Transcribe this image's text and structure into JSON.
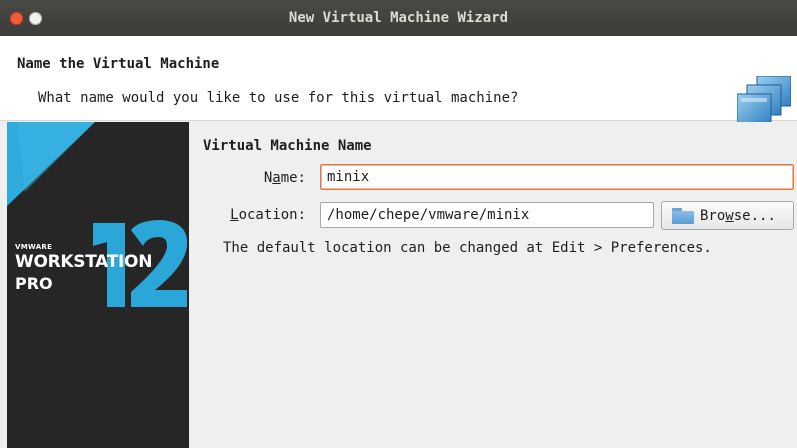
{
  "window": {
    "title": "New Virtual Machine Wizard"
  },
  "header": {
    "title": "Name the Virtual Machine",
    "subtitle": "What name would you like to use for this virtual machine?",
    "icon": "virtual-machine-stack-icon"
  },
  "banner": {
    "vendor": "VMWARE",
    "product": "WORKSTATION",
    "edition": "PRO",
    "version": "12",
    "colors": {
      "accent": "#2eaadc",
      "background": "#262626"
    }
  },
  "form": {
    "section_title": "Virtual Machine Name",
    "name": {
      "label_pre": "N",
      "label_mnemonic": "a",
      "label_post": "me:",
      "value": "minix"
    },
    "location": {
      "label_pre": "",
      "label_mnemonic": "L",
      "label_post": "ocation:",
      "value": "/home/chepe/vmware/minix"
    },
    "browse": {
      "label_pre": "Bro",
      "label_mnemonic": "w",
      "label_post": "se...",
      "icon": "folder-icon"
    },
    "hint": "The default location can be changed at Edit > Preferences."
  }
}
